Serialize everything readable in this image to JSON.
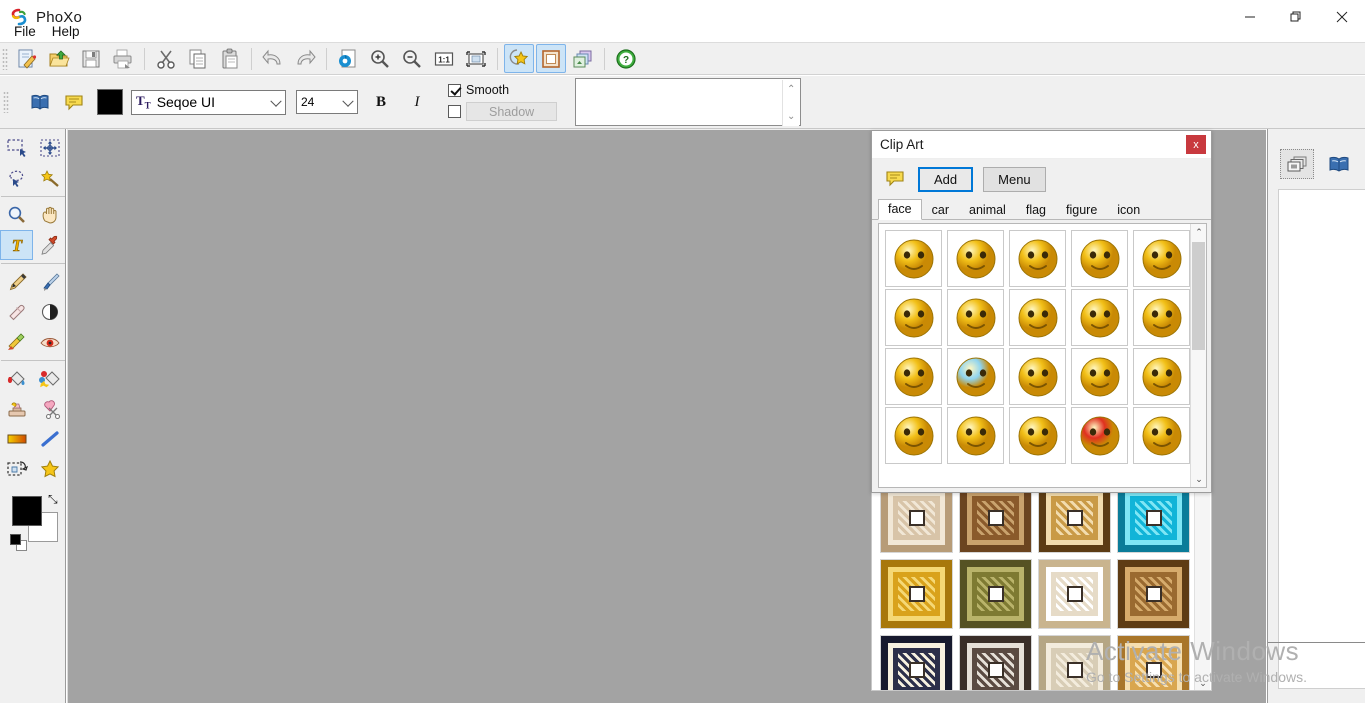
{
  "window": {
    "title": "PhoXo",
    "app_icon": "phoxo-logo-icon",
    "minimize": "—",
    "maximize": "❐",
    "close": "✕"
  },
  "menubar": {
    "items": [
      {
        "label": "File",
        "name": "menu-file"
      },
      {
        "label": "Help",
        "name": "menu-help"
      }
    ]
  },
  "toolbar": {
    "buttons": [
      {
        "name": "new-document-button",
        "icon": "new-document-icon",
        "active": false
      },
      {
        "name": "open-file-button",
        "icon": "open-folder-icon",
        "active": false
      },
      {
        "name": "save-button",
        "icon": "floppy-save-icon",
        "active": false
      },
      {
        "name": "print-button",
        "icon": "printer-icon",
        "active": false
      },
      {
        "name": "cut-button",
        "icon": "scissors-icon",
        "active": false
      },
      {
        "name": "copy-button",
        "icon": "copy-icon",
        "active": false
      },
      {
        "name": "paste-button",
        "icon": "paste-clipboard-icon",
        "active": false
      },
      {
        "name": "undo-button",
        "icon": "undo-arrow-icon",
        "active": false
      },
      {
        "name": "redo-button",
        "icon": "redo-arrow-icon",
        "active": false
      },
      {
        "name": "refresh-button",
        "icon": "refresh-page-icon",
        "active": false
      },
      {
        "name": "zoom-in-button",
        "icon": "magnifier-plus-icon",
        "active": false
      },
      {
        "name": "zoom-out-button",
        "icon": "magnifier-minus-icon",
        "active": false
      },
      {
        "name": "actual-size-button",
        "icon": "one-to-one-icon",
        "label": "1:1",
        "active": false
      },
      {
        "name": "fit-screen-button",
        "icon": "fit-to-screen-icon",
        "active": false
      },
      {
        "name": "clipart-button",
        "icon": "star-clipart-icon",
        "active": true
      },
      {
        "name": "frames-button",
        "icon": "frame-border-icon",
        "active": true
      },
      {
        "name": "layers-button",
        "icon": "layers-stack-icon",
        "active": false
      },
      {
        "name": "help-button",
        "icon": "help-question-icon",
        "active": false
      }
    ]
  },
  "text_options": {
    "library_icon": "book-library-icon",
    "bubble_icon": "speech-bubble-icon",
    "color_label": "text-color",
    "color_value": "#000000",
    "font_family": "Seqoe UI",
    "font_size": "24",
    "bold_label": "B",
    "italic_label": "I",
    "smooth_label": "Smooth",
    "smooth_checked": true,
    "shadow_label": "Shadow",
    "shadow_checked": false,
    "text_value": "",
    "text_placeholder": "",
    "spin_up": "⌃",
    "spin_down": "⌄"
  },
  "tools": {
    "groups": [
      [
        {
          "name": "tool-rectangle-select",
          "icon": "rectangle-marquee-icon",
          "selected": false
        },
        {
          "name": "tool-move",
          "icon": "move-crosshair-icon",
          "selected": false
        },
        {
          "name": "tool-lasso-select",
          "icon": "lasso-select-icon",
          "selected": false
        },
        {
          "name": "tool-magic-wand",
          "icon": "magic-wand-icon",
          "selected": false
        }
      ],
      [
        {
          "name": "tool-zoom",
          "icon": "magnifier-icon",
          "selected": false
        },
        {
          "name": "tool-hand-pan",
          "icon": "hand-pan-icon",
          "selected": false
        },
        {
          "name": "tool-text",
          "icon": "text-t-icon",
          "selected": true
        },
        {
          "name": "tool-eyedropper",
          "icon": "eyedropper-icon",
          "selected": false
        }
      ],
      [
        {
          "name": "tool-pen",
          "icon": "pen-nib-icon",
          "selected": false
        },
        {
          "name": "tool-brush",
          "icon": "paint-brush-icon",
          "selected": false
        },
        {
          "name": "tool-eraser",
          "icon": "eraser-icon",
          "selected": false
        },
        {
          "name": "tool-dodge-burn",
          "icon": "dodge-burn-circle-icon",
          "selected": false
        },
        {
          "name": "tool-smudge",
          "icon": "smudge-icon",
          "selected": false
        },
        {
          "name": "tool-red-eye",
          "icon": "red-eye-icon",
          "selected": false
        }
      ],
      [
        {
          "name": "tool-paint-bucket",
          "icon": "paint-bucket-icon",
          "selected": false
        },
        {
          "name": "tool-color-replace",
          "icon": "color-replace-bucket-icon",
          "selected": false
        },
        {
          "name": "tool-stamp",
          "icon": "rubber-stamp-icon",
          "selected": false
        },
        {
          "name": "tool-cut-shape",
          "icon": "heart-scissors-icon",
          "selected": false
        },
        {
          "name": "tool-gradient",
          "icon": "gradient-bar-icon",
          "selected": false
        },
        {
          "name": "tool-line",
          "icon": "line-icon",
          "selected": false
        },
        {
          "name": "tool-transform",
          "icon": "transform-box-icon",
          "selected": false
        },
        {
          "name": "tool-effects",
          "icon": "star-effects-icon",
          "selected": false
        }
      ]
    ],
    "foreground_color": "#000000",
    "background_color": "#ffffff",
    "swap_icon": "swap-colors-icon",
    "swap_glyph": "⤡"
  },
  "right_panel": {
    "tabs": [
      {
        "name": "panel-tab-layers",
        "icon": "layers-stack-icon",
        "selected": true
      },
      {
        "name": "panel-tab-library",
        "icon": "book-library-icon",
        "selected": false
      }
    ]
  },
  "clip_art_dialog": {
    "title": "Clip Art",
    "close_label": "x",
    "bubble_icon": "speech-bubble-icon",
    "add_label": "Add",
    "menu_label": "Menu",
    "tabs": [
      {
        "label": "face",
        "selected": true
      },
      {
        "label": "car",
        "selected": false
      },
      {
        "label": "animal",
        "selected": false
      },
      {
        "label": "flag",
        "selected": false
      },
      {
        "label": "figure",
        "selected": false
      },
      {
        "label": "icon",
        "selected": false
      }
    ],
    "scroll_up": "⌃",
    "scroll_down": "⌄",
    "items": [
      {
        "name": "clipart-item-shy-blush",
        "glyph": "😳",
        "color": "#f2c018"
      },
      {
        "name": "clipart-item-yawn",
        "glyph": "😪",
        "color": "#f2c018"
      },
      {
        "name": "clipart-item-surprised",
        "glyph": "😮",
        "color": "#f2c018"
      },
      {
        "name": "clipart-item-sleeping-book",
        "glyph": "😴",
        "color": "#f2c018"
      },
      {
        "name": "clipart-item-dizzy-x-eyes",
        "glyph": "😵",
        "color": "#f2c018"
      },
      {
        "name": "clipart-item-heart-eyes-kiss",
        "glyph": "😍",
        "color": "#f2c018"
      },
      {
        "name": "clipart-item-sunglasses-cigar",
        "glyph": "😎",
        "color": "#f2c018"
      },
      {
        "name": "clipart-item-squint-blush",
        "glyph": "😖",
        "color": "#f2c018"
      },
      {
        "name": "clipart-item-big-grin",
        "glyph": "😁",
        "color": "#f2c018"
      },
      {
        "name": "clipart-item-zipper-mouth",
        "glyph": "🤐",
        "color": "#f2c018"
      },
      {
        "name": "clipart-item-angry-brows",
        "glyph": "😠",
        "color": "#f2c018"
      },
      {
        "name": "clipart-item-cold-frozen",
        "glyph": "🥶",
        "color": "#8fd4f0"
      },
      {
        "name": "clipart-item-kanji-face",
        "glyph": "😫",
        "color": "#f2c018"
      },
      {
        "name": "clipart-item-crying-streams",
        "glyph": "😭",
        "color": "#f2c018"
      },
      {
        "name": "clipart-item-sad-frown",
        "glyph": "☹",
        "color": "#f2c018"
      },
      {
        "name": "clipart-item-gritted-teeth",
        "glyph": "😬",
        "color": "#f2c018"
      },
      {
        "name": "clipart-item-drooling",
        "glyph": "🤤",
        "color": "#f2c018"
      },
      {
        "name": "clipart-item-happy-smile",
        "glyph": "😃",
        "color": "#f2c018"
      },
      {
        "name": "clipart-item-devil",
        "glyph": "😈",
        "color": "#e03020"
      },
      {
        "name": "clipart-item-eating-noodles",
        "glyph": "🍜",
        "color": "#f2c018"
      }
    ]
  },
  "frames_panel": {
    "name": "frames-browser",
    "scroll_down": "⌄",
    "rows": [
      [
        {
          "name": "frame-thumb-cream-ornate",
          "c1": "#d8c4a8",
          "c2": "#f1e7d6",
          "c3": "#b79c78"
        },
        {
          "name": "frame-thumb-dark-wood",
          "c1": "#8a5a2b",
          "c2": "#c9a26d",
          "c3": "#6b4420"
        },
        {
          "name": "frame-thumb-bevel-oak",
          "c1": "#c99a46",
          "c2": "#f2dcae",
          "c3": "#5c3c14"
        },
        {
          "name": "frame-thumb-teal-mosaic",
          "c1": "#11b4d8",
          "c2": "#7fe6f5",
          "c3": "#0a7c99"
        }
      ],
      [
        {
          "name": "frame-thumb-gold-gilt",
          "c1": "#d9a21b",
          "c2": "#f5d875",
          "c3": "#a8780c"
        },
        {
          "name": "frame-thumb-olive-carved",
          "c1": "#7e7a32",
          "c2": "#b9b36a",
          "c3": "#565223"
        },
        {
          "name": "frame-thumb-lace-pattern",
          "c1": "#e6dbc7",
          "c2": "#ffffff",
          "c3": "#c9b48e"
        },
        {
          "name": "frame-thumb-chevron-wood",
          "c1": "#9a6a30",
          "c2": "#d6ab6c",
          "c3": "#5e3c14"
        }
      ],
      [
        {
          "name": "frame-thumb-navy-rope",
          "c1": "#2c2f4a",
          "c2": "#f7f1e0",
          "c3": "#171a2e"
        },
        {
          "name": "frame-thumb-grey-layered",
          "c1": "#5a4a42",
          "c2": "#e6e0d8",
          "c3": "#3a2e28"
        },
        {
          "name": "frame-thumb-beige-damask",
          "c1": "#d8cdb6",
          "c2": "#f3ecdd",
          "c3": "#b5a684"
        },
        {
          "name": "frame-thumb-amber-swirl",
          "c1": "#d9a64f",
          "c2": "#f6dfb0",
          "c3": "#a9762a"
        }
      ]
    ]
  },
  "watermark": {
    "line1": "Activate Windows",
    "line2": "Go to Settings to activate Windows."
  }
}
